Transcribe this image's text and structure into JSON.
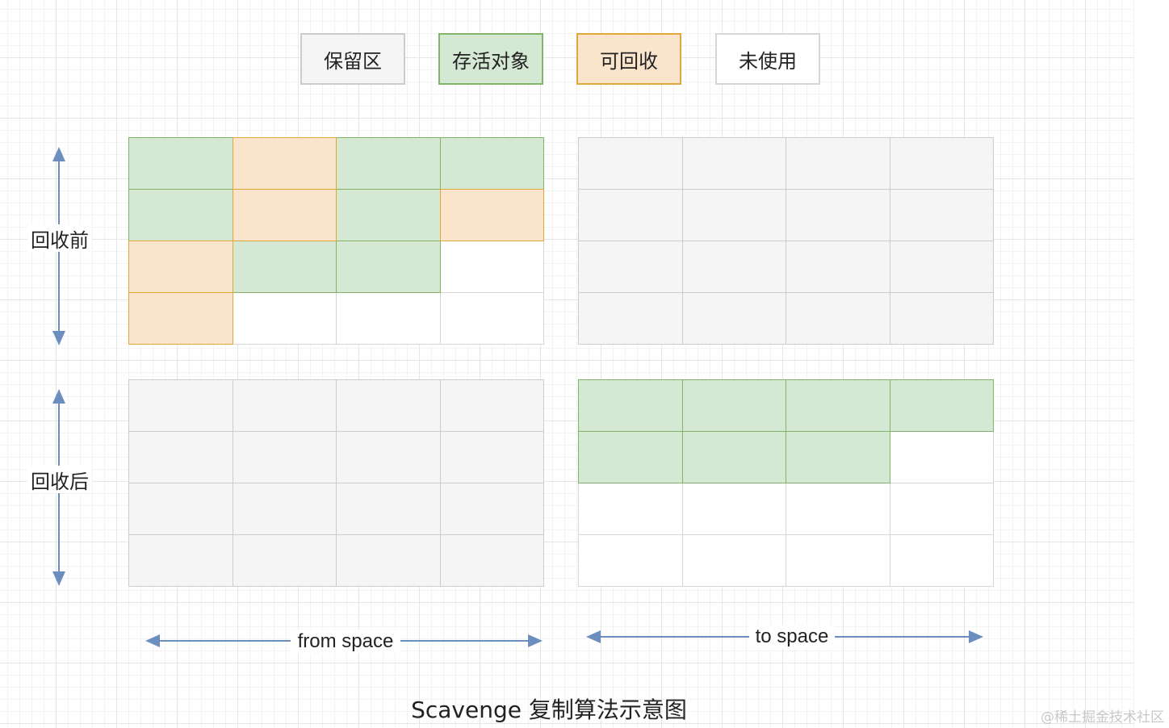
{
  "legend": [
    {
      "key": "reserved",
      "label": "保留区"
    },
    {
      "key": "live",
      "label": "存活对象"
    },
    {
      "key": "reclaimable",
      "label": "可回收"
    },
    {
      "key": "unused",
      "label": "未使用"
    }
  ],
  "colors": {
    "reserved": {
      "fill": "#f5f5f5",
      "stroke": "#cccccc"
    },
    "live": {
      "fill": "#d5e8d4",
      "stroke": "#82b366"
    },
    "reclaimable": {
      "fill": "#fae5cc",
      "stroke": "#e0a83b"
    },
    "unused": {
      "fill": "#ffffff",
      "stroke": "#d6d6d6"
    },
    "arrow": "#6c8ebf"
  },
  "row_labels": {
    "before": "回收前",
    "after": "回收后"
  },
  "space_labels": {
    "from": "from space",
    "to": "to space"
  },
  "grids": {
    "before_from": [
      [
        "live",
        "reclaimable",
        "live",
        "live"
      ],
      [
        "live",
        "reclaimable",
        "live",
        "reclaimable"
      ],
      [
        "reclaimable",
        "live",
        "live",
        "unused"
      ],
      [
        "reclaimable",
        "unused",
        "unused",
        "unused"
      ]
    ],
    "before_to": [
      [
        "reserved",
        "reserved",
        "reserved",
        "reserved"
      ],
      [
        "reserved",
        "reserved",
        "reserved",
        "reserved"
      ],
      [
        "reserved",
        "reserved",
        "reserved",
        "reserved"
      ],
      [
        "reserved",
        "reserved",
        "reserved",
        "reserved"
      ]
    ],
    "after_from": [
      [
        "reserved",
        "reserved",
        "reserved",
        "reserved"
      ],
      [
        "reserved",
        "reserved",
        "reserved",
        "reserved"
      ],
      [
        "reserved",
        "reserved",
        "reserved",
        "reserved"
      ],
      [
        "reserved",
        "reserved",
        "reserved",
        "reserved"
      ]
    ],
    "after_to": [
      [
        "live",
        "live",
        "live",
        "live"
      ],
      [
        "live",
        "live",
        "live",
        "unused"
      ],
      [
        "unused",
        "unused",
        "unused",
        "unused"
      ],
      [
        "unused",
        "unused",
        "unused",
        "unused"
      ]
    ]
  },
  "caption": "Scavenge 复制算法示意图",
  "watermark": "@稀土掘金技术社区"
}
